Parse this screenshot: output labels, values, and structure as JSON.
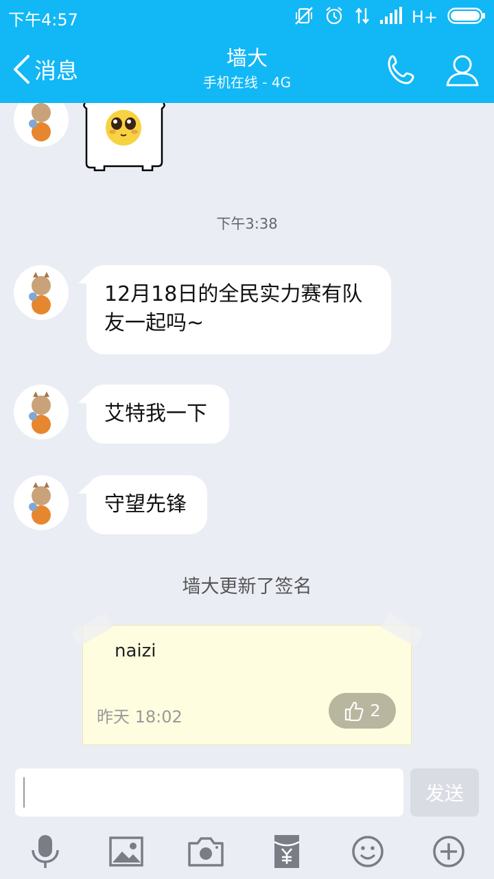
{
  "status_bar": {
    "time": "下午4:57",
    "network": "H+"
  },
  "header": {
    "back_label": "消息",
    "title": "墙大",
    "subtitle": "手机在线 - 4G"
  },
  "chat": {
    "timestamp": "下午3:38",
    "messages": [
      {
        "line1": "12月18日的全民实力赛有队",
        "line2": "友一起吗~"
      },
      {
        "text": "艾特我一下"
      },
      {
        "text": "守望先锋"
      }
    ],
    "system_message": "墙大更新了签名",
    "signature": {
      "text": "naizi",
      "time": "昨天 18:02",
      "likes": "2"
    }
  },
  "input": {
    "placeholder": "",
    "send_label": "发送"
  },
  "toolbar": {
    "icons": [
      "microphone-icon",
      "image-icon",
      "camera-icon",
      "red-packet-icon",
      "emoji-icon",
      "plus-icon"
    ]
  },
  "colors": {
    "accent": "#12b7f5",
    "background": "#ebedf5",
    "signature_card": "#fffde0"
  }
}
